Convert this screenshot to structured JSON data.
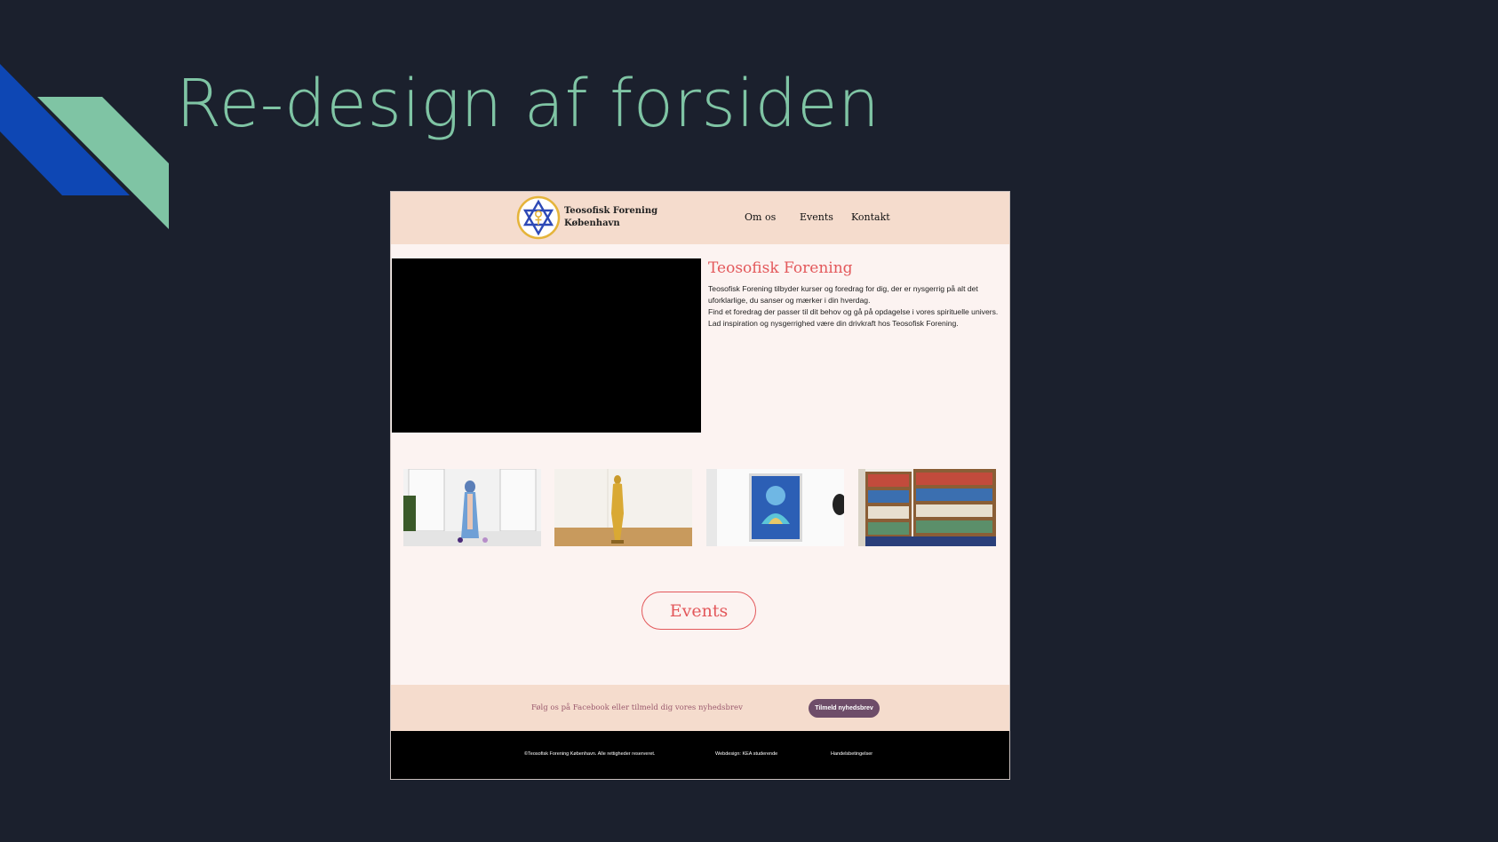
{
  "slide": {
    "title": "Re-design af forsiden",
    "colors": {
      "background": "#1b202d",
      "accent_green": "#7fc4a4",
      "accent_blue": "#0e47b4"
    }
  },
  "mockup": {
    "header": {
      "logo_icon": "star-of-david-ankh-logo-icon",
      "logo_line1": "Teosofisk Forening",
      "logo_line2": "København",
      "nav": [
        "Om os",
        "Events",
        "Kontakt"
      ]
    },
    "intro": {
      "title": "Teosofisk Forening",
      "paragraph1": "Teosofisk Forening tilbyder kurser og foredrag for dig, der er nysgerrig på alt det uforklarlige, du sanser og mærker i din hverdag.",
      "paragraph2": "Find et foredrag der passer til dit behov og gå på opdagelse i vores spirituelle univers. Lad inspiration og nysgerrighed være din drivkraft hos Teosofisk Forening."
    },
    "gallery_icons": [
      "madonna-statue-photo",
      "golden-buddha-photo",
      "lotus-painting-photo",
      "bookshelf-photo"
    ],
    "events_button": "Events",
    "newsletter": {
      "text": "Følg os på Facebook eller tilmeld dig vores nyhedsbrev",
      "button": "Tilmeld nyhedsbrev"
    },
    "footer": {
      "copyright": "©Teosofisk Forening København. Alle rettigheder reserveret.",
      "webdesign": "Webdesign: KEA studerende",
      "terms": "Handelsbetingelser"
    },
    "colors": {
      "header_bg": "#f5dccd",
      "page_bg": "#fcf3f1",
      "accent_red": "#e3585b",
      "button_purple": "#6e4d69"
    }
  }
}
